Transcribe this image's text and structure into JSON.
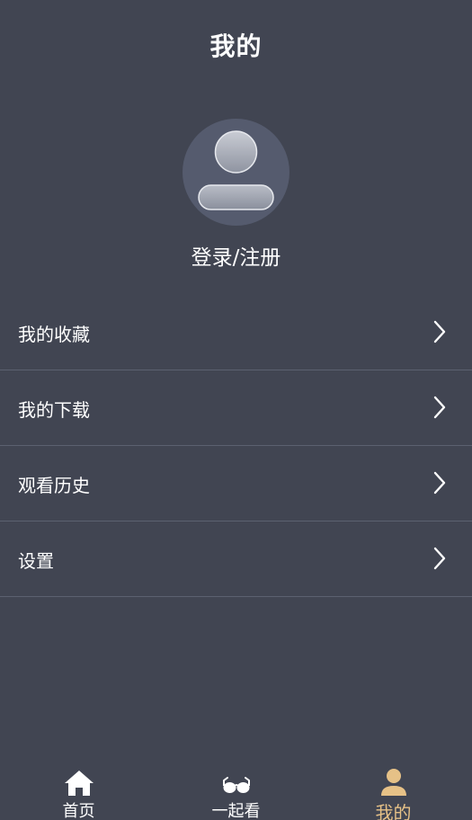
{
  "header": {
    "title": "我的"
  },
  "profile": {
    "login_text": "登录/注册",
    "avatar_icon": "user-avatar-icon"
  },
  "menu": {
    "items": [
      {
        "label": "我的收藏",
        "icon": "chevron-right-icon"
      },
      {
        "label": "我的下载",
        "icon": "chevron-right-icon"
      },
      {
        "label": "观看历史",
        "icon": "chevron-right-icon"
      },
      {
        "label": "设置",
        "icon": "chevron-right-icon"
      }
    ]
  },
  "tabbar": {
    "tabs": [
      {
        "label": "首页",
        "icon": "home-icon",
        "active": false
      },
      {
        "label": "一起看",
        "icon": "glasses-icon",
        "active": false
      },
      {
        "label": "我的",
        "icon": "person-icon",
        "active": true
      }
    ],
    "active_color": "#e6c187"
  },
  "colors": {
    "background": "#414552",
    "divider": "#5c6170",
    "avatar_bg": "#555b6e"
  }
}
